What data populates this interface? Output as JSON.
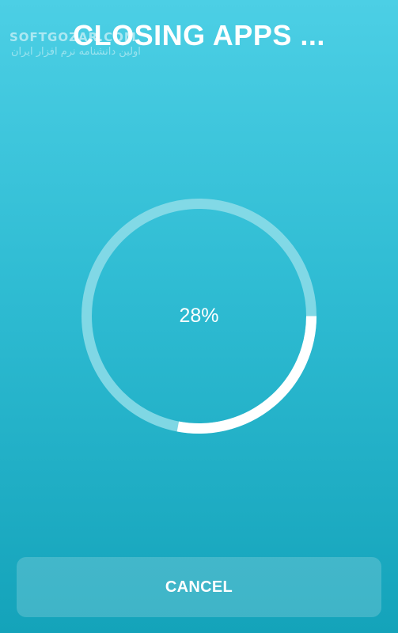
{
  "watermark": {
    "brand": "SOFTGOZAR.COM",
    "tagline": "اولین دانشنامه نرم افزار ایران"
  },
  "header": {
    "title": "CLOSING APPS ..."
  },
  "progress": {
    "value": 0.28,
    "label": "28%",
    "track_color": "#8fdde9",
    "fill_color": "#ffffff"
  },
  "footer": {
    "cancel_label": "CANCEL"
  }
}
